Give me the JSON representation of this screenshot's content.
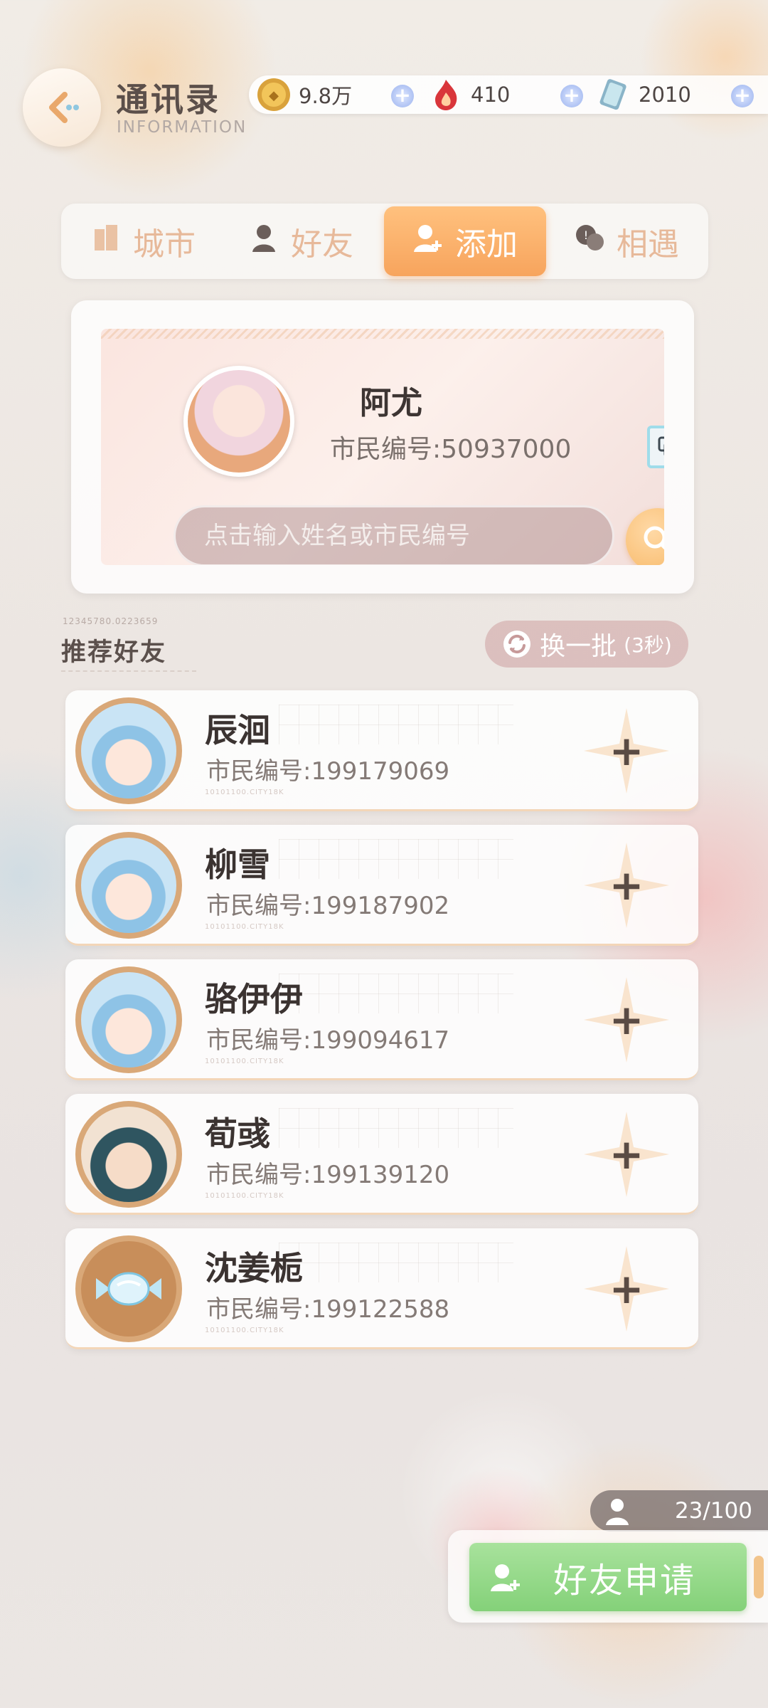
{
  "header": {
    "title": "通讯录",
    "subtitle": "INFORMATION"
  },
  "currencies": [
    {
      "icon": "gold-coin-icon",
      "value": "9.8万"
    },
    {
      "icon": "flame-gem-icon",
      "value": "410"
    },
    {
      "icon": "crystal-card-icon",
      "value": "2010"
    }
  ],
  "tabs": [
    {
      "label": "城市",
      "icon": "building-icon",
      "active": false
    },
    {
      "label": "好友",
      "icon": "person-icon",
      "active": false
    },
    {
      "label": "添加",
      "icon": "add-person-icon",
      "active": true
    },
    {
      "label": "相遇",
      "icon": "chat-bubbles-icon",
      "active": false
    }
  ],
  "profile": {
    "name": "阿尤",
    "id_label": "市民编号:50937000"
  },
  "search": {
    "placeholder": "点击输入姓名或市民编号"
  },
  "recommend": {
    "deco": "12345780.0223659",
    "title": "推荐好友",
    "refresh_label": "换一批",
    "refresh_count": "(3秒)"
  },
  "friends": [
    {
      "name": "辰洄",
      "id_label": "市民编号:199179069",
      "avatar": "girl"
    },
    {
      "name": "柳雪",
      "id_label": "市民编号:199187902",
      "avatar": "girl"
    },
    {
      "name": "骆伊伊",
      "id_label": "市民编号:199094617",
      "avatar": "girl"
    },
    {
      "name": "荀彧",
      "id_label": "市民编号:199139120",
      "avatar": "boy"
    },
    {
      "name": "沈姜栀",
      "id_label": "市民编号:199122588",
      "avatar": "candy"
    }
  ],
  "friend_deco": "10101100.CITY18K",
  "friend_count": "23/100",
  "apply_button": "好友申请",
  "colors": {
    "accent_orange": "#f7a45d",
    "apply_green": "#84d179",
    "refresh_pink": "#d2aaaa"
  }
}
